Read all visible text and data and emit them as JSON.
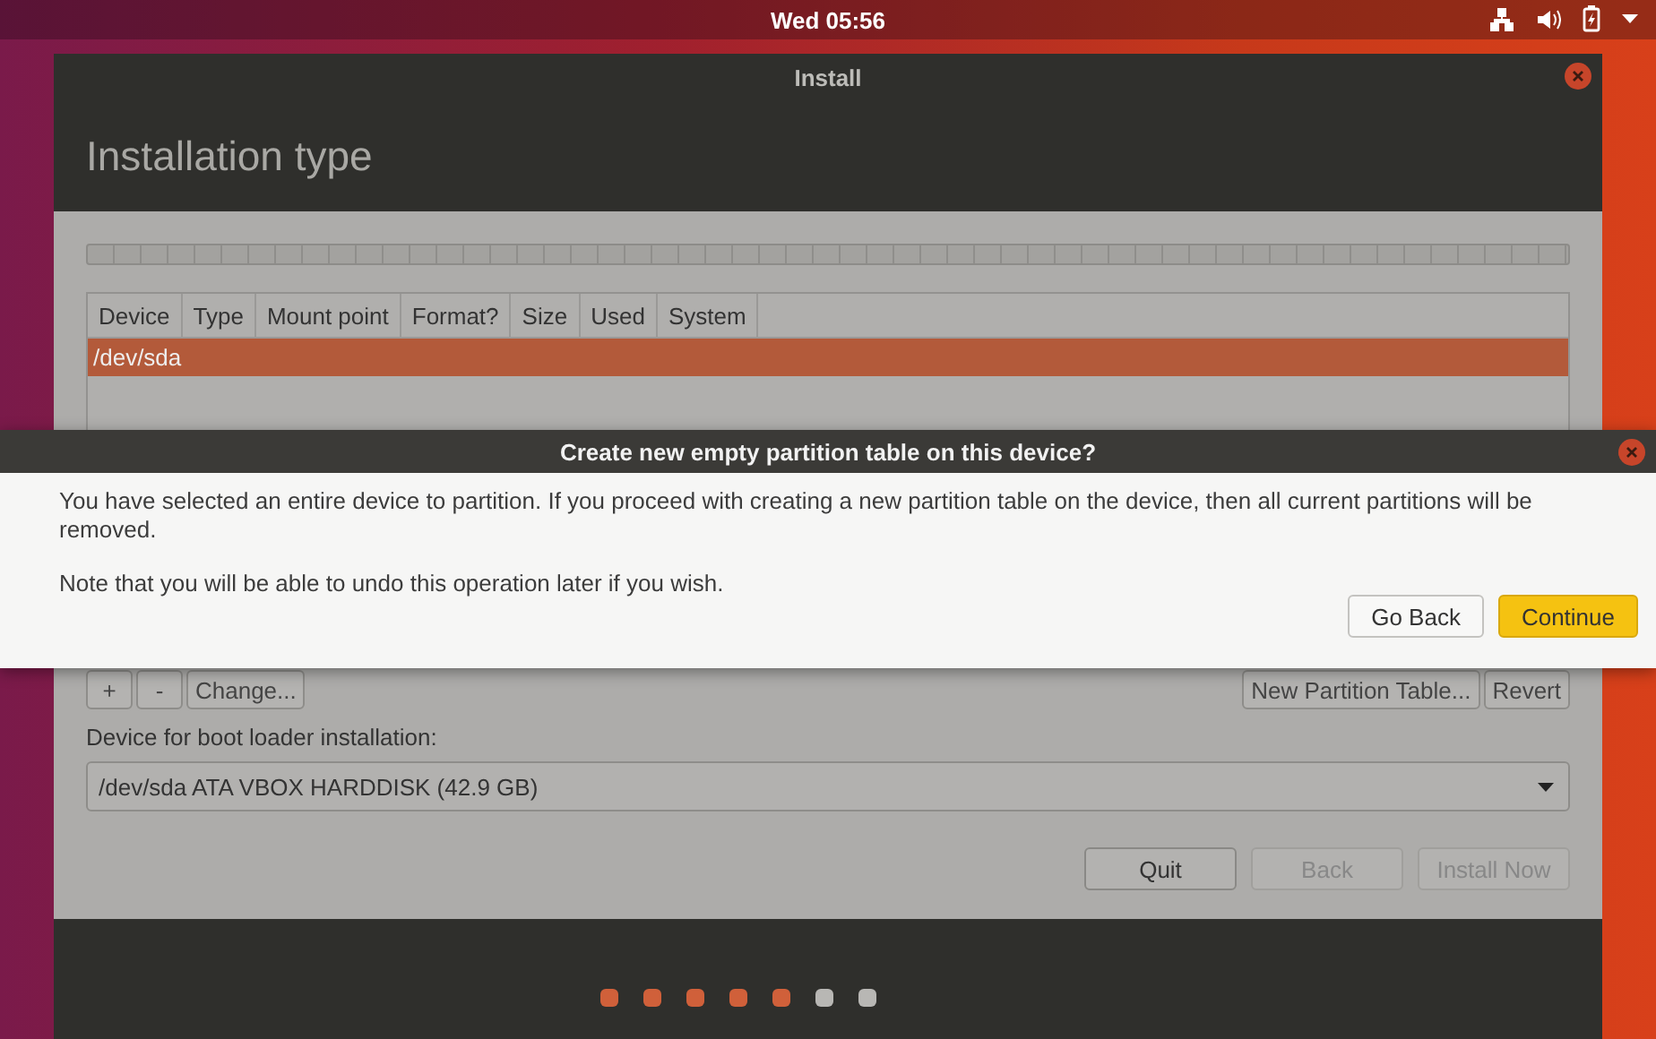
{
  "top_bar": {
    "clock": "Wed 05:56"
  },
  "window": {
    "title": "Install",
    "heading": "Installation type"
  },
  "partition_table": {
    "columns": [
      "Device",
      "Type",
      "Mount point",
      "Format?",
      "Size",
      "Used",
      "System"
    ],
    "rows": [
      {
        "device": "/dev/sda",
        "selected": true
      }
    ]
  },
  "partition_buttons": {
    "left": [
      "+",
      "-",
      "Change..."
    ],
    "right": [
      "New Partition Table...",
      "Revert"
    ]
  },
  "boot_loader": {
    "label": "Device for boot loader installation:",
    "value": "/dev/sda ATA VBOX HARDDISK (42.9 GB)"
  },
  "buttons": [
    {
      "label": "Quit",
      "disabled": false
    },
    {
      "label": "Back",
      "disabled": true
    },
    {
      "label": "Install Now",
      "disabled": true
    }
  ],
  "progress_steps": [
    {
      "done": true
    },
    {
      "done": true
    },
    {
      "done": true
    },
    {
      "done": true
    },
    {
      "done": true
    },
    {
      "done": false
    },
    {
      "done": false
    }
  ],
  "dialog": {
    "title": "Create new empty partition table on this device?",
    "paragraphs": [
      "You have selected an entire device to partition. If you proceed with creating a new partition table on the device, then all current partitions will be removed.",
      "Note that you will be able to undo this operation later if you wish."
    ],
    "buttons": [
      {
        "label": "Go Back",
        "suggested": false
      },
      {
        "label": "Continue",
        "suggested": true
      }
    ]
  }
}
